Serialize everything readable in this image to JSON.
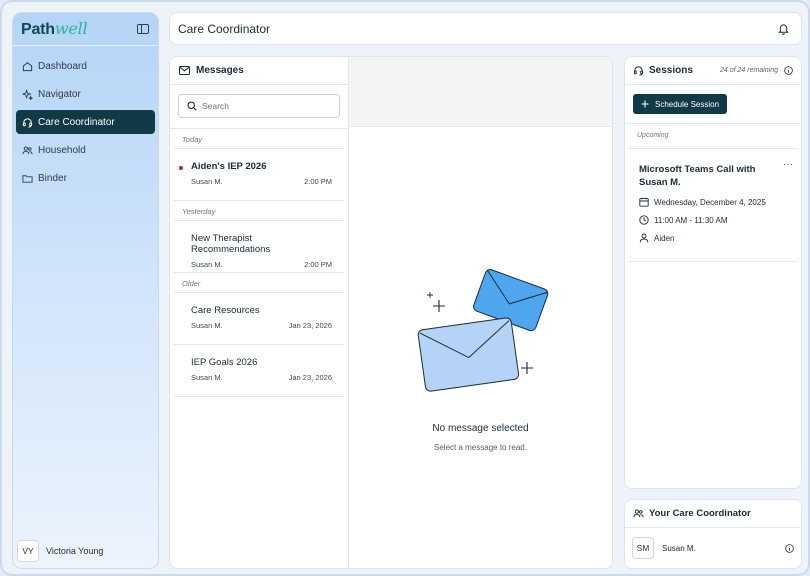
{
  "app": {
    "brand_main": "Path",
    "brand_script": "well"
  },
  "sidebar": {
    "items": [
      {
        "label": "Dashboard",
        "icon": "home-icon",
        "active": false
      },
      {
        "label": "Navigator",
        "icon": "sparkle-icon",
        "active": false
      },
      {
        "label": "Care Coordinator",
        "icon": "headset-icon",
        "active": true
      },
      {
        "label": "Household",
        "icon": "people-icon",
        "active": false
      },
      {
        "label": "Binder",
        "icon": "folder-icon",
        "active": false
      }
    ],
    "user": {
      "initials": "VY",
      "name": "Victoria Young"
    }
  },
  "header": {
    "title": "Care Coordinator"
  },
  "messages": {
    "title": "Messages",
    "search_placeholder": "Search",
    "groups": [
      {
        "label": "Today",
        "items": [
          {
            "subject": "Aiden's IEP 2026",
            "sender": "Susan M.",
            "time": "2:00 PM",
            "unread": true
          }
        ]
      },
      {
        "label": "Yesterday",
        "items": [
          {
            "subject": "New Therapist Recommendations",
            "sender": "Susan M.",
            "time": "2:00 PM",
            "unread": false
          }
        ]
      },
      {
        "label": "Older",
        "items": [
          {
            "subject": "Care Resources",
            "sender": "Susan M.",
            "time": "Jan 23, 2026",
            "unread": false
          },
          {
            "subject": "IEP Goals 2026",
            "sender": "Susan M.",
            "time": "Jan 23, 2026",
            "unread": false
          }
        ]
      }
    ],
    "empty_title": "No message selected",
    "empty_subtitle": "Select a message to read."
  },
  "sessions": {
    "title": "Sessions",
    "remaining": "24 of 24 remaining",
    "schedule_label": "Schedule Session",
    "upcoming_label": "Upcoming",
    "event": {
      "title": "Microsoft Teams Call with Susan M.",
      "date": "Wednesday, December 4, 2025",
      "time": "11:00 AM - 11:30 AM",
      "attendee": "Aiden",
      "more": "···"
    }
  },
  "coordinator": {
    "title": "Your Care Coordinator",
    "initials": "SM",
    "name": "Susan M."
  },
  "colors": {
    "primary": "#0f3a46",
    "unread_dot": "#c2185b",
    "brand_accent": "#2bb5a0"
  }
}
